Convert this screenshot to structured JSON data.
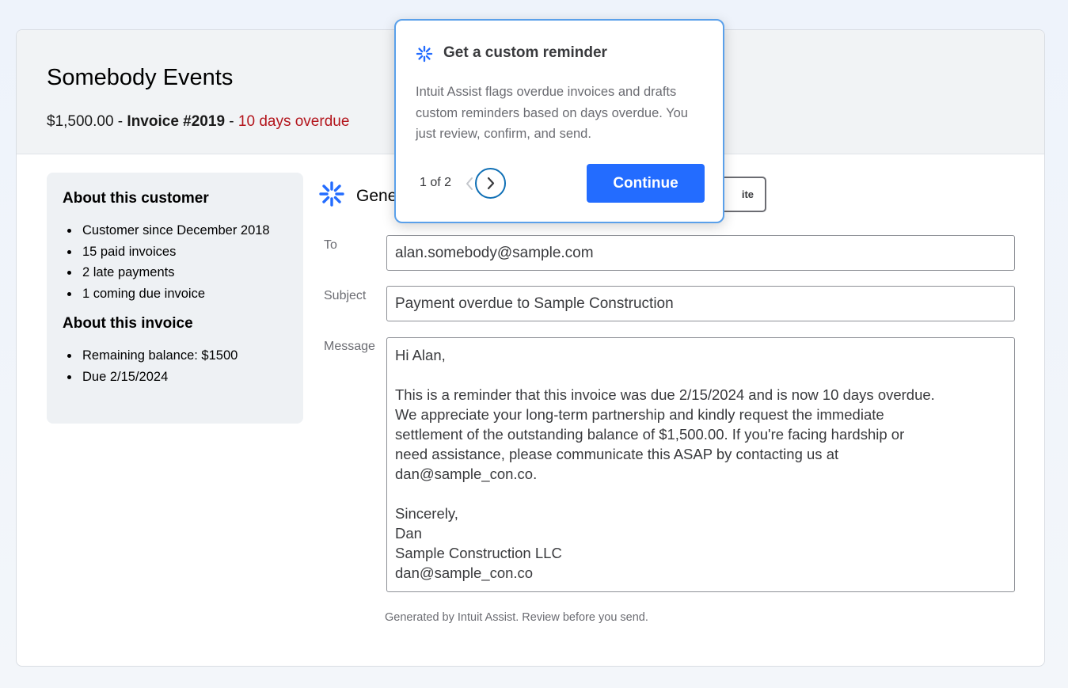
{
  "header": {
    "customer_name": "Somebody Events",
    "amount": "$1,500.00",
    "sep1": " - ",
    "invoice_number": "Invoice #2019",
    "sep2": " - ",
    "overdue_text": "10 days overdue",
    "overdue_color": "#b3151c"
  },
  "sidebar": {
    "customer_heading": "About this customer",
    "customer_items": [
      "Customer since December 2018",
      "15 paid invoices",
      "2 late payments",
      "1 coming due invoice"
    ],
    "invoice_heading": "About this invoice",
    "invoice_items": [
      "Remaining balance: $1500",
      "Due 2/15/2024"
    ]
  },
  "generator": {
    "label": "Gene",
    "rewrite_label": "ite",
    "icon": "sparkle-icon"
  },
  "form": {
    "to_label": "To",
    "to_value": "alan.somebody@sample.com",
    "subject_label": "Subject",
    "subject_value": "Payment overdue to Sample Construction",
    "message_label": "Message",
    "message_lines": {
      "greeting": "Hi Alan,",
      "l1": "This is a reminder that this invoice was due 2/15/2024 and is now 10 days overdue.",
      "l2": "We appreciate your long-term partnership and kindly request the immediate",
      "l3": "settlement of the outstanding balance of $1,500.00. If you're facing hardship or",
      "l4": "need assistance, please communicate this ASAP by contacting us at",
      "l5": "dan@sample_con.co.",
      "s1": "Sincerely,",
      "s2": "Dan",
      "s3": "Sample Construction LLC",
      "s4": "dan@sample_con.co"
    },
    "footnote": "Generated by Intuit Assist. Review before you send."
  },
  "popover": {
    "title": "Get a custom reminder",
    "body": "Intuit Assist flags overdue invoices and drafts custom reminders based on days overdue. You just review, confirm, and send.",
    "pager": "1 of 2",
    "continue_label": "Continue",
    "accent_color": "#236cff"
  }
}
